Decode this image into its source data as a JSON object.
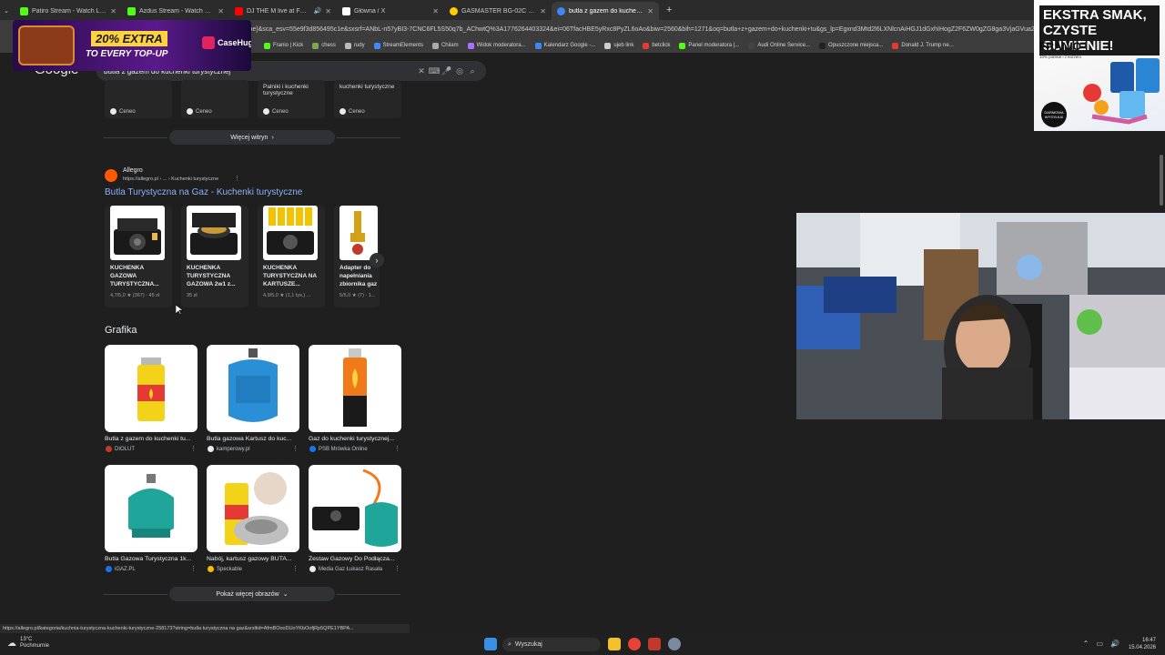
{
  "tabs": [
    {
      "title": "Patiro Stream - Watch Live on",
      "color": "#53fc18"
    },
    {
      "title": "Azdus Stream - Watch Live on",
      "color": "#53fc18"
    },
    {
      "title": "DJ THE M live at FESTIVAL",
      "color": "#ff0000"
    },
    {
      "title": "Główna / X",
      "color": "#ffffff"
    },
    {
      "title": "GASMASTER BG-02C Kuchenka",
      "color": "#ffcc00"
    },
    {
      "title": "butla z gazem do kuchenki tury",
      "color": "#4285f4"
    }
  ],
  "address": "zne}&sca_esv=55e9f3d856495c1e&sxsrf=ANbL-n57yBI3-7CNC6FL5S50q7b_AChwtQ%3A1776264403324&ei=06TfacHBE5yRxc8PyZL6oAo&biw=2560&bih=1271&oq=butla+z+gazem+do+kuchenki+tu&gs_lp=Egxnd3Mtd2l6LXNlcnAiHGJ1dGxhIHogZ2F6ZW0gZG8ga3VjaGVua2kgdHU",
  "bookmarks": [
    "Franio | Kick",
    "chess",
    "rudy",
    "StreamElements",
    "Chilam",
    "Widok moderatora...",
    "Kalendarz Google -...",
    "ujeb link",
    "betclick",
    "Panel moderatora |...",
    "Audi Online Service...",
    "Opuszczone miejsca...",
    "Donald J. Trump ne..."
  ],
  "google": {
    "logo": "Google",
    "query": "butla z gazem do kuchenki turystycznej"
  },
  "mini_cards": [
    {
      "text": "",
      "source": "Ceneo"
    },
    {
      "text": "",
      "source": "Ceneo"
    },
    {
      "text": "Palniki i kuchenki turystyczne",
      "source": "Ceneo"
    },
    {
      "text": "kuchenki turystyczne",
      "source": "Ceneo"
    }
  ],
  "more_sites": "Więcej witryn",
  "allegro": {
    "name": "Allegro",
    "url": "https://allegro.pl › ... › Kuchenki turystyczne",
    "title": "Butla Turystyczna na Gaz - Kuchenki turystyczne"
  },
  "products": [
    {
      "name": "KUCHENKA GAZOWA TURYSTYCZNA...",
      "meta": "4,7/5,0 ★ (367) · 45 zł"
    },
    {
      "name": "KUCHENKA TURYSTYCZNA GAZOWA 2w1 z...",
      "meta": "35 zł"
    },
    {
      "name": "KUCHENKA TURYSTYCZNA NA KARTUSZE...",
      "meta": "4,9/5,0 ★ (1,1 tys.) ..."
    },
    {
      "name": "Adapter do napełniania zbiornika gaz",
      "meta": "5/5,0 ★ (7) · 1..."
    }
  ],
  "grafika_heading": "Grafika",
  "images": [
    {
      "caption": "Butla z gazem do kuchenki tu...",
      "source": "DIOLUT",
      "dot": "#c0392b"
    },
    {
      "caption": "Butla gazowa Kartusz do kuc...",
      "source": "kamperowy.pl",
      "dot": "#e8eaed"
    },
    {
      "caption": "Gaz do kuchenki turystycznej...",
      "source": "PSB Mrówka Online",
      "dot": "#1a73e8"
    },
    {
      "caption": "Butla Gazowa Turystyczna 1k...",
      "source": "iGAZ.PL",
      "dot": "#1a73e8"
    },
    {
      "caption": "Nabój, kartusz gazowy BUTA...",
      "source": "Speckable",
      "dot": "#fbbc04"
    },
    {
      "caption": "Zestaw Gazowy Do Podłącza...",
      "source": "Media Gaz Łukasz Rasała",
      "dot": "#e8eaed"
    }
  ],
  "more_images": "Pokaż więcej obrazów",
  "status_url": "https://allegro.pl/kategoria/kuchnia-turystyczna-kuchenki-turystyczne-258173?string=butla turystyczna na gaz&srsltid=AfmBOooDUoYKbOofjRp5QPE1YBPA...",
  "taskbar": {
    "temp": "13°C",
    "weather": "Pochmurnie",
    "search": "Wyszukaj",
    "time": "16:47",
    "date": "15.04.2026"
  },
  "ad": {
    "headline": "EKSTRA SMAK, CZYSTE SUMIENIE!",
    "brand": "FRANIO",
    "sub": "10% polskie i z korzeni",
    "badge": "DARMOWA WYSYŁKA!"
  },
  "banner": {
    "line1": "20% EXTRA",
    "line2": "TO EVERY TOP-UP",
    "logo": "CaseHug"
  }
}
